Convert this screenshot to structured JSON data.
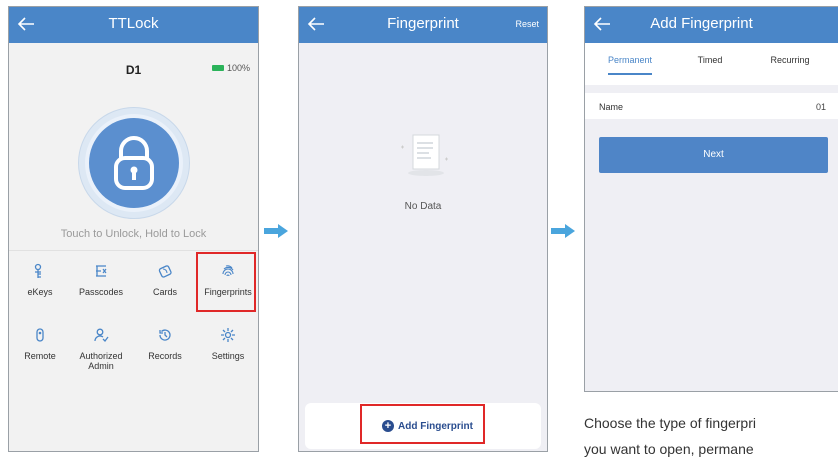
{
  "colors": {
    "primary": "#4a86c8",
    "highlight": "#e02828",
    "battery": "#2bb35a",
    "arrow": "#4aa5dd"
  },
  "screen1": {
    "title": "TTLock",
    "lock_name": "D1",
    "battery": "100%",
    "hint": "Touch to Unlock, Hold to Lock",
    "menu": [
      {
        "label": "eKeys",
        "icon": "ekey-icon"
      },
      {
        "label": "Passcodes",
        "icon": "passcode-icon"
      },
      {
        "label": "Cards",
        "icon": "card-icon"
      },
      {
        "label": "Fingerprints",
        "icon": "fingerprint-icon"
      },
      {
        "label": "Remote",
        "icon": "remote-icon"
      },
      {
        "label": "Authorized Admin",
        "icon": "admin-icon"
      },
      {
        "label": "Records",
        "icon": "records-icon"
      },
      {
        "label": "Settings",
        "icon": "settings-icon"
      }
    ]
  },
  "screen2": {
    "title": "Fingerprint",
    "reset_label": "Reset",
    "empty_text": "No Data",
    "add_label": "Add Fingerprint"
  },
  "screen3": {
    "title": "Add Fingerprint",
    "tabs": [
      {
        "label": "Permanent"
      },
      {
        "label": "Timed"
      },
      {
        "label": "Recurring"
      }
    ],
    "active_tab": "Permanent",
    "name_label": "Name",
    "name_value": "01",
    "next_label": "Next"
  },
  "caption": {
    "line1": "Choose the type of fingerpri",
    "line2": "you want to open, permane"
  }
}
